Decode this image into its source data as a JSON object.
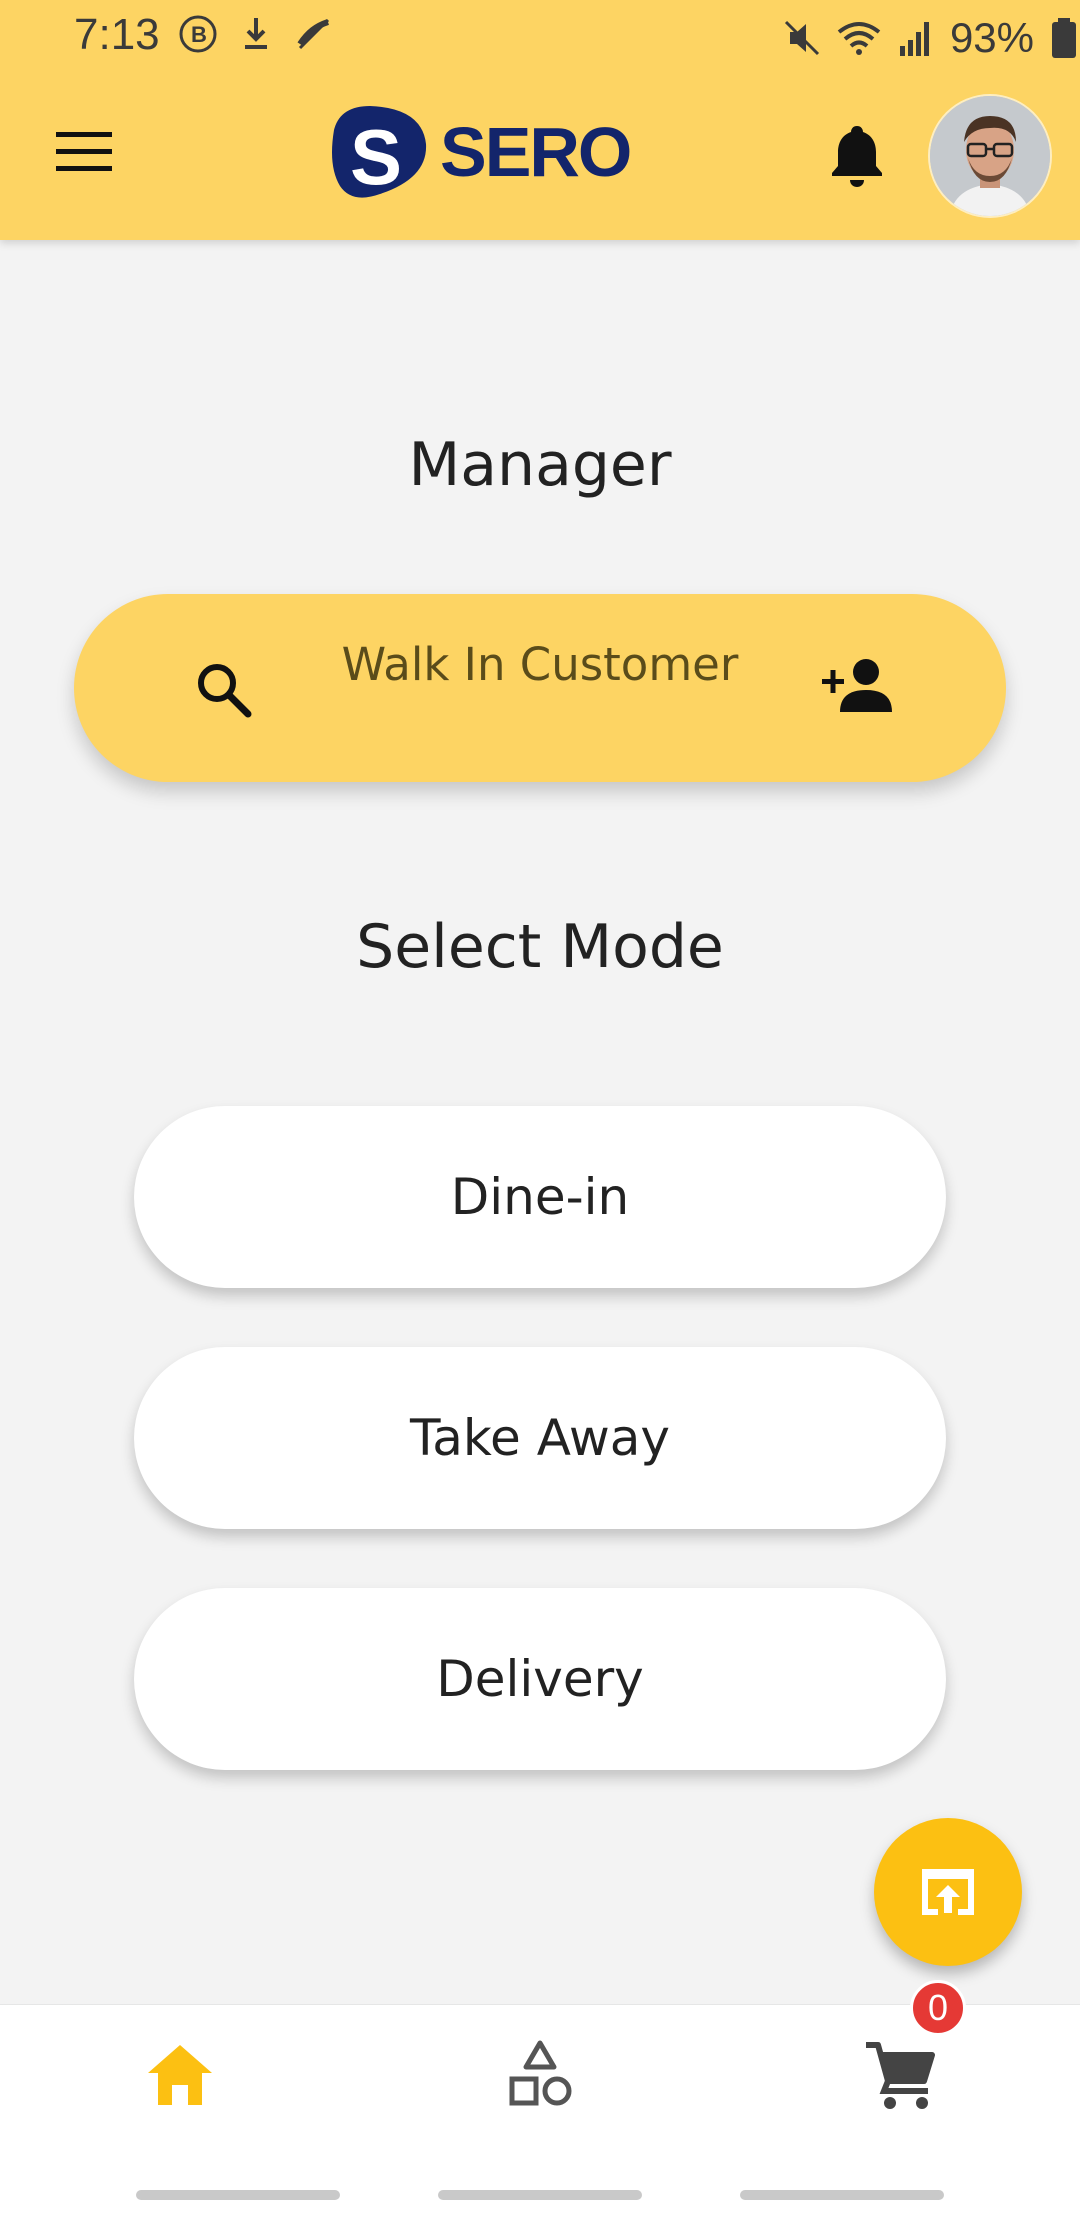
{
  "status_bar": {
    "time": "7:13",
    "battery": "93%"
  },
  "app_bar": {
    "logo_text": "SERO",
    "logo_mark": "S"
  },
  "main": {
    "role_title": "Manager",
    "customer_selector": {
      "label": "Walk In Customer"
    },
    "mode_title": "Select Mode",
    "modes": [
      {
        "label": "Dine-in"
      },
      {
        "label": "Take Away"
      },
      {
        "label": "Delivery"
      }
    ]
  },
  "bottom_nav": {
    "cart_count": "0"
  },
  "colors": {
    "accent_yellow": "#FDD463",
    "fab_yellow": "#FCC012",
    "brand_navy": "#13256B",
    "badge_red": "#E53935"
  },
  "icons": [
    "menu-icon",
    "bell-icon",
    "search-icon",
    "add-person-icon",
    "open-in-app-icon",
    "home-icon",
    "shapes-icon",
    "cart-icon"
  ]
}
